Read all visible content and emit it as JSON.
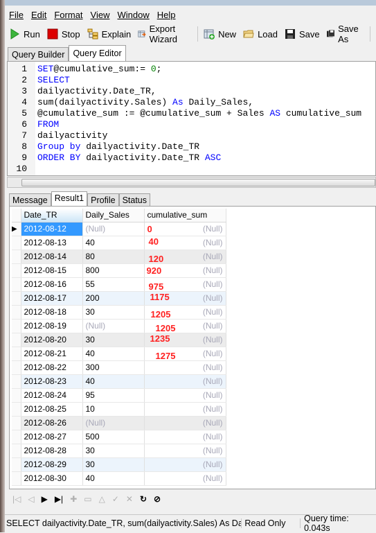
{
  "menu": [
    "File",
    "Edit",
    "Format",
    "View",
    "Window",
    "Help"
  ],
  "toolbar": {
    "run": "Run",
    "stop": "Stop",
    "explain": "Explain",
    "export": "Export Wizard",
    "new": "New",
    "load": "Load",
    "save": "Save",
    "save_as": "Save As"
  },
  "editor_tabs": [
    "Query Builder",
    "Query Editor"
  ],
  "code": [
    [
      [
        "kw",
        "SET"
      ],
      [
        "",
        "@cumulative_sum:= "
      ],
      [
        "num",
        "0"
      ],
      [
        "",
        ";"
      ]
    ],
    [
      [
        "kw",
        "SELECT"
      ]
    ],
    [
      [
        "",
        "dailyactivity.Date_TR,"
      ]
    ],
    [
      [
        "",
        "sum(dailyactivity.Sales) "
      ],
      [
        "kw",
        "As"
      ],
      [
        "",
        " Daily_Sales,"
      ]
    ],
    [
      [
        "",
        "@cumulative_sum := @cumulative_sum + Sales "
      ],
      [
        "kw",
        "AS"
      ],
      [
        "",
        " cumulative_sum"
      ]
    ],
    [
      [
        "kw",
        "FROM"
      ]
    ],
    [
      [
        "",
        "dailyactivity"
      ]
    ],
    [
      [
        "kw",
        "Group by"
      ],
      [
        "",
        " dailyactivity.Date_TR"
      ]
    ],
    [
      [
        "kw",
        "ORDER BY"
      ],
      [
        "",
        " dailyactivity.Date_TR "
      ],
      [
        "kw",
        "ASC"
      ]
    ],
    []
  ],
  "result_tabs": [
    "Message",
    "Result1",
    "Profile",
    "Status"
  ],
  "columns": [
    "Date_TR",
    "Daily_Sales",
    "cumulative_sum"
  ],
  "null_text": "(Null)",
  "rows": [
    {
      "date": "2012-08-12",
      "sales": null,
      "note": "0"
    },
    {
      "date": "2012-08-13",
      "sales": "40",
      "note": "40"
    },
    {
      "date": "2012-08-14",
      "sales": "80",
      "note": "120"
    },
    {
      "date": "2012-08-15",
      "sales": "800",
      "note": "920"
    },
    {
      "date": "2012-08-16",
      "sales": "55",
      "note": "975"
    },
    {
      "date": "2012-08-17",
      "sales": "200",
      "note": "1175"
    },
    {
      "date": "2012-08-18",
      "sales": "30",
      "note": "1205"
    },
    {
      "date": "2012-08-19",
      "sales": null,
      "note": "1205"
    },
    {
      "date": "2012-08-20",
      "sales": "30",
      "note": "1235"
    },
    {
      "date": "2012-08-21",
      "sales": "40",
      "note": "1275"
    },
    {
      "date": "2012-08-22",
      "sales": "300"
    },
    {
      "date": "2012-08-23",
      "sales": "40"
    },
    {
      "date": "2012-08-24",
      "sales": "95"
    },
    {
      "date": "2012-08-25",
      "sales": "10"
    },
    {
      "date": "2012-08-26",
      "sales": null
    },
    {
      "date": "2012-08-27",
      "sales": "500"
    },
    {
      "date": "2012-08-28",
      "sales": "30"
    },
    {
      "date": "2012-08-29",
      "sales": "30"
    },
    {
      "date": "2012-08-30",
      "sales": "40"
    }
  ],
  "status": {
    "sql": "SELECT dailyactivity.Date_TR, sum(dailyactivity.Sales) As Daily_Sales",
    "mode": "Read Only",
    "time": "Query time: 0.043s"
  },
  "colors": {
    "annotation": "#ff2020",
    "keyword": "#0000ff",
    "selection": "#3399ff"
  }
}
